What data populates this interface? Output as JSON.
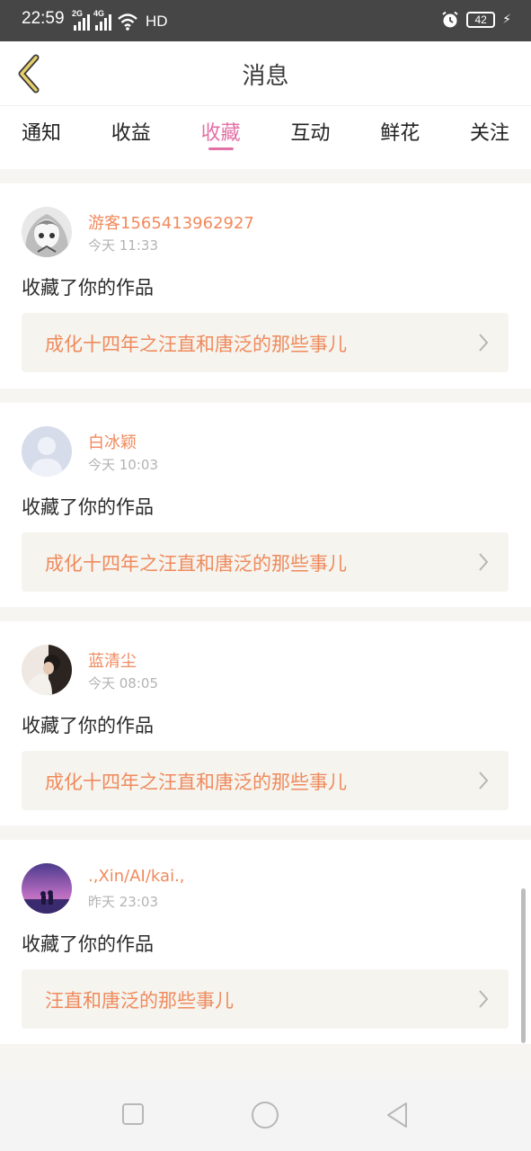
{
  "status_bar": {
    "time": "22:59",
    "signal_1_type": "2G",
    "signal_2_type": "4G",
    "network_label": "HD",
    "battery_level": "42"
  },
  "header": {
    "title": "消息"
  },
  "tabs": [
    {
      "label": "通知"
    },
    {
      "label": "收益"
    },
    {
      "label": "收藏",
      "active": true
    },
    {
      "label": "互动"
    },
    {
      "label": "鲜花"
    },
    {
      "label": "关注"
    }
  ],
  "messages": [
    {
      "username": "游客1565413962927",
      "time": "今天 11:33",
      "action": "收藏了你的作品",
      "work_title": "成化十四年之汪直和唐泛的那些事儿",
      "avatar": "anime-girl-avatar"
    },
    {
      "username": "白冰颖",
      "time": "今天 10:03",
      "action": "收藏了你的作品",
      "work_title": "成化十四年之汪直和唐泛的那些事儿",
      "avatar": "default-avatar"
    },
    {
      "username": "蓝清尘",
      "time": "今天 08:05",
      "action": "收藏了你的作品",
      "work_title": "成化十四年之汪直和唐泛的那些事儿",
      "avatar": "photo-avatar"
    },
    {
      "username": ".,Xin/AI/kai.,",
      "time": "昨天 23:03",
      "action": "收藏了你的作品",
      "work_title": "汪直和唐泛的那些事儿",
      "avatar": "sunset-avatar"
    }
  ],
  "colors": {
    "accent": "#e270a6",
    "username": "#f08a5d",
    "back_arrow": "#d9b84a"
  },
  "nav_bar": {
    "icons": [
      "square-icon",
      "circle-icon",
      "triangle-back-icon"
    ]
  }
}
